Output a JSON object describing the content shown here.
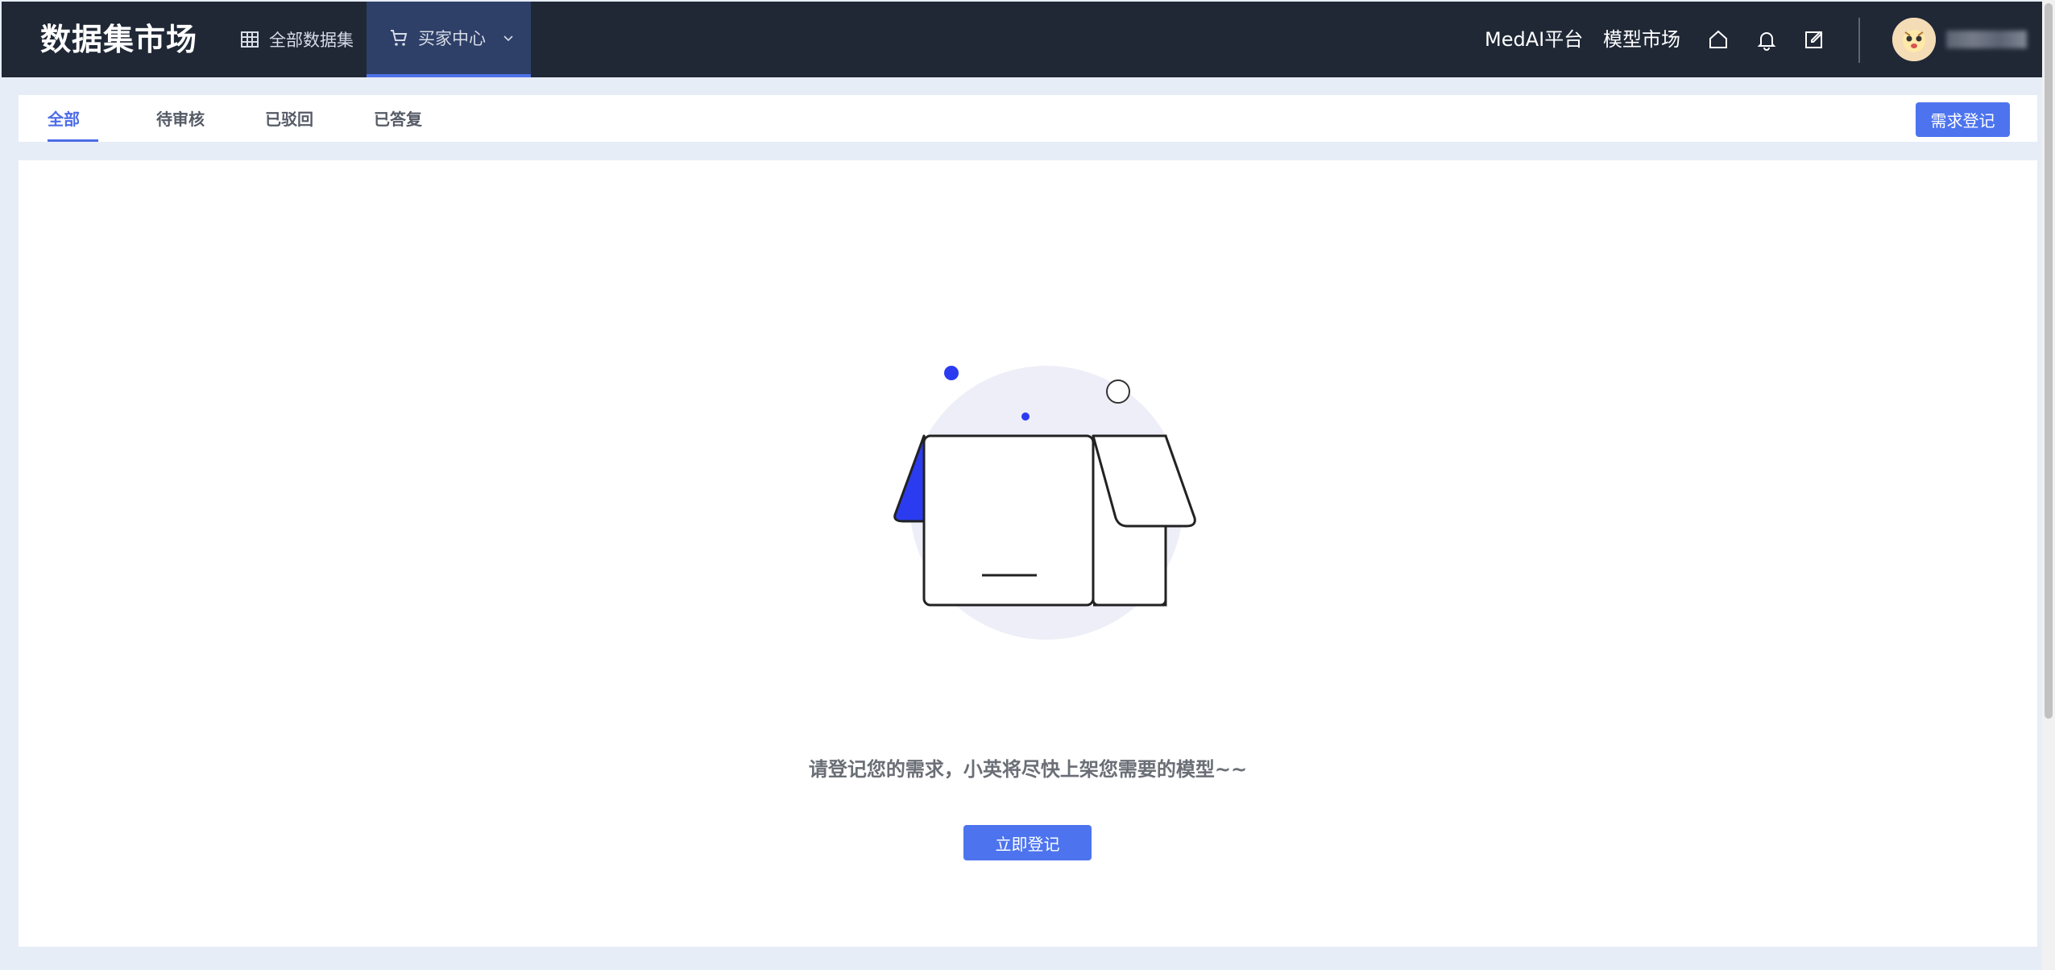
{
  "brand": "数据集市场",
  "nav": {
    "all_datasets": "全部数据集",
    "buyer_center": "买家中心"
  },
  "right_links": {
    "medai": "MedAI平台",
    "model_market": "模型市场"
  },
  "icons": {
    "dataset": "grid-icon",
    "cart": "cart-icon",
    "home": "home-icon",
    "bell": "bell-icon",
    "edit": "edit-icon",
    "chevron": "chevron-down-icon"
  },
  "tabs": [
    {
      "label": "全部",
      "active": true
    },
    {
      "label": "待审核",
      "active": false
    },
    {
      "label": "已驳回",
      "active": false
    },
    {
      "label": "已答复",
      "active": false
    }
  ],
  "top_button": "需求登记",
  "empty": {
    "message": "请登记您的需求，小英将尽快上架您需要的模型~~",
    "button": "立即登记"
  },
  "colors": {
    "topbar": "#202836",
    "accent": "#4d74ee",
    "active_nav": "#2e3f68",
    "illus_blue": "#2b3cf0"
  }
}
